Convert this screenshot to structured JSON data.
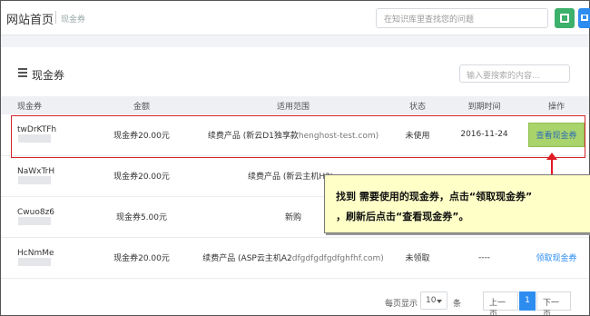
{
  "header": {
    "brand": "网站首页",
    "breadcrumb": "现金券",
    "search_placeholder": "在知识库里查找您的问题"
  },
  "panel": {
    "title": "现金券",
    "search_placeholder": "输入要搜索的内容..."
  },
  "table": {
    "columns": [
      "现金券",
      "金额",
      "适用范围",
      "状态",
      "到期时间",
      "操作"
    ],
    "rows": [
      {
        "code": "twDrKTFh",
        "amount": "现金券20.00元",
        "scope": "续费产品 (新云D1独享款",
        "scope_tail": "henghost-test.com)",
        "status": "未使用",
        "expiry": "2016-11-24",
        "action": "查看现金券"
      },
      {
        "code": "NaWxTrH",
        "amount": "现金券20.00元",
        "scope": "续费产品 (新云主机H2ta",
        "scope_tail": "",
        "status": "",
        "expiry": "",
        "action": ""
      },
      {
        "code": "Cwuo8z6",
        "amount": "现金券5.00元",
        "scope": "新购",
        "scope_tail": "",
        "status": "",
        "expiry": "",
        "action": ""
      },
      {
        "code": "HcNmMe",
        "amount": "现金券20.00元",
        "scope": "续费产品 (ASP云主机A2",
        "scope_tail": "dfgdfgdfgdfghfhf.com)",
        "status": "未领取",
        "expiry": "----",
        "action": "领取现金券"
      }
    ]
  },
  "callout": {
    "line1": "找到 需要使用的现金券，点击“领取现金券”",
    "line2": "，刷新后点击“查看现金券”。"
  },
  "pager": {
    "per_page_label": "每页显示",
    "per_page_value": "10",
    "unit": "条",
    "prev": "上一页",
    "current": "1",
    "next": "下一页"
  },
  "colors": {
    "accent": "#2d8cf0",
    "highlight_border": "#d2232a",
    "callout_bg": "#ffffc8"
  }
}
